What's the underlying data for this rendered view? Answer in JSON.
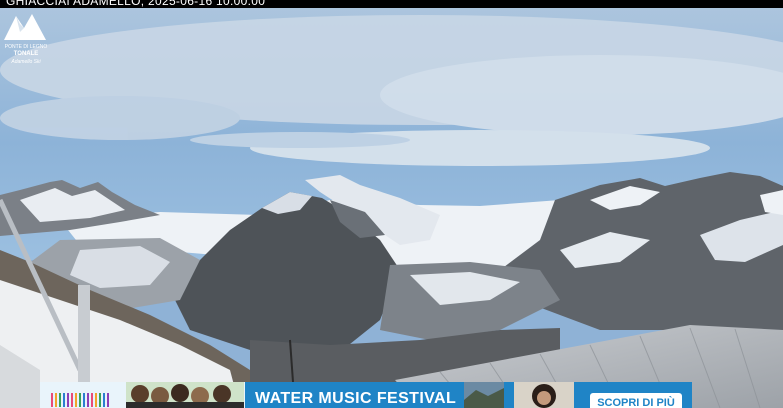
{
  "camera": {
    "caption": "GHIACCIAI ADAMELLO, 2025-06-16 10:00:00"
  },
  "logo": {
    "line1": "PONTE DI LEGNO",
    "line2": "TONALE",
    "line3": "Adamello Ski"
  },
  "banner": {
    "title": "WATER MUSIC FESTIVAL",
    "button_label": "SCOPRI DI PIÙ",
    "accent": "#1f84c6"
  },
  "palette": {
    "sky": "#8fb2d6",
    "snow": "#eef2f6",
    "rock": "#4e5358"
  }
}
